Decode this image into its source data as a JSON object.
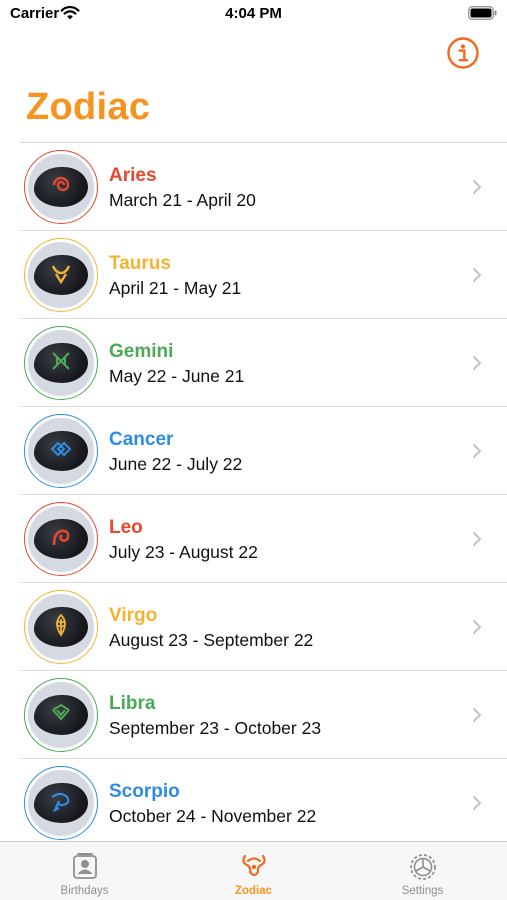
{
  "status_bar": {
    "carrier": "Carrier",
    "time": "4:04 PM"
  },
  "header": {
    "title": "Zodiac",
    "title_color": "#f7931e",
    "info_icon": "info-circle-icon"
  },
  "signs": [
    {
      "name": "Aries",
      "dates": "March 21 - April 20",
      "color": "#e8472c"
    },
    {
      "name": "Taurus",
      "dates": "April 21 - May 21",
      "color": "#f2b432"
    },
    {
      "name": "Gemini",
      "dates": "May 22 - June 21",
      "color": "#4caa57"
    },
    {
      "name": "Cancer",
      "dates": "June 22 - July 22",
      "color": "#2e8ce6"
    },
    {
      "name": "Leo",
      "dates": "July 23 - August 22",
      "color": "#e8472c"
    },
    {
      "name": "Virgo",
      "dates": "August 23 - September 22",
      "color": "#f2b432"
    },
    {
      "name": "Libra",
      "dates": "September 23 - October 23",
      "color": "#4caa57"
    },
    {
      "name": "Scorpio",
      "dates": "October 24 - November 22",
      "color": "#2e8ce6"
    }
  ],
  "tab_bar": {
    "tabs": [
      {
        "label": "Birthdays",
        "icon": "person-card-icon",
        "active": false
      },
      {
        "label": "Zodiac",
        "icon": "zodiac-icon",
        "active": true
      },
      {
        "label": "Settings",
        "icon": "gear-icon",
        "active": false
      }
    ],
    "active_color": "#f7931e",
    "inactive_color": "#8e8e93"
  }
}
